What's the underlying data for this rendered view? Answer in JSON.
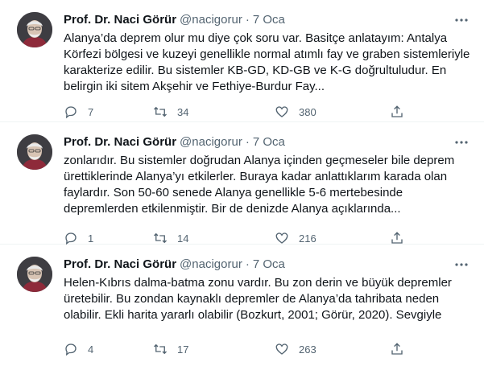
{
  "tweets": [
    {
      "name": "Prof. Dr. Naci Görür",
      "handle": "@nacigorur",
      "separator": "·",
      "date": "7 Oca",
      "lines": [
        "Alanya’da deprem olur mu diye çok soru var. Basitçe anlatayım: Antalya",
        "Körfezi bölgesi ve kuzeyi  genellikle normal atımlı fay ve graben sistemleriyle",
        "karakterize edilir. Bu sistemler KB-GD, KD-GB ve K-G doğrultuludur. En",
        "belirgin iki sitem Akşehir ve Fethiye-Burdur Fay..."
      ],
      "replies": "7",
      "retweets": "34",
      "likes": "380"
    },
    {
      "name": "Prof. Dr. Naci Görür",
      "handle": "@nacigorur",
      "separator": "·",
      "date": "7 Oca",
      "lines": [
        "zonlarıdır. Bu sistemler doğrudan Alanya içinden geçmeseler bile deprem",
        "ürettiklerinde Alanya’yı etkilerler. Buraya kadar anlattıklarım karada olan",
        "faylardır. Son 50-60 senede Alanya genellikle 5-6 mertebesinde",
        "depremlerden etkilenmiştir. Bir de denizde Alanya açıklarında..."
      ],
      "replies": "1",
      "retweets": "14",
      "likes": "216"
    },
    {
      "name": "Prof. Dr. Naci Görür",
      "handle": "@nacigorur",
      "separator": "·",
      "date": "7 Oca",
      "lines": [
        "Helen-Kıbrıs dalma-batma zonu vardır. Bu zon derin ve büyük depremler",
        "üretebilir. Bu zondan kaynaklı depremler de Alanya’da tahribata neden",
        "olabilir. Ekli harita yararlı olabilir (Bozkurt, 2001; Görür, 2020). Sevgiyle"
      ],
      "replies": "4",
      "retweets": "17",
      "likes": "263"
    }
  ],
  "icons": {
    "more": "more-dots-icon",
    "reply": "reply-icon",
    "retweet": "retweet-icon",
    "like": "heart-icon",
    "share": "share-icon"
  },
  "colors": {
    "text": "#0f1419",
    "secondary": "#536471",
    "divider": "#eff3f4"
  }
}
